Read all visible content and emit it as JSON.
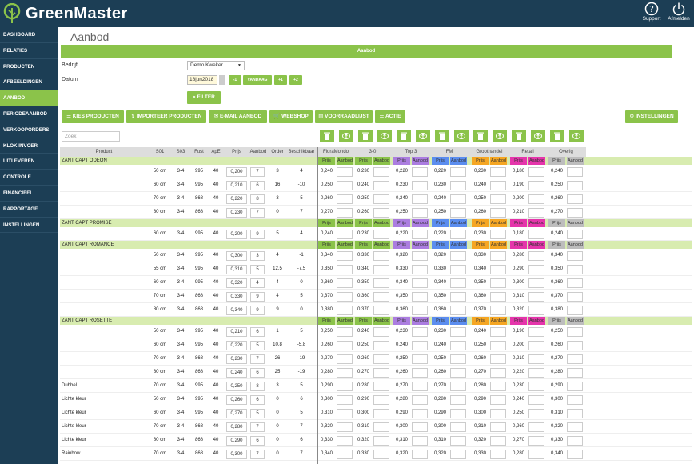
{
  "app": {
    "name": "GreenMaster",
    "support": "Support",
    "logout": "Afmelden"
  },
  "nav": [
    "DASHBOARD",
    "RELATIES",
    "PRODUCTEN",
    "AFBEELDINGEN",
    "AANBOD",
    "PERIODEAANBOD",
    "VERKOOPORDERS",
    "KLOK INVOER",
    "UITLEVEREN",
    "CONTROLE",
    "FINANCIEEL",
    "RAPPORTAGE",
    "INSTELLINGEN"
  ],
  "page": {
    "title": "Aanbod",
    "band": "Aanbod",
    "bedrijf_label": "Bedrijf",
    "bedrijf_value": "Demo Kweker",
    "datum_label": "Datum",
    "datum_value": "18jun2018",
    "day_buttons": [
      "-1",
      "VANDAAG",
      "+1",
      "+2"
    ],
    "filter": "FILTER",
    "actions": [
      "KIES PRODUCTEN",
      "IMPORTEER PRODUCTEN",
      "E-MAIL AANBOD",
      "WEBSHOP",
      "VOORRAADLIJST",
      "ACTIE"
    ],
    "settings": "INSTELLINGEN",
    "search_placeholder": "Zoek"
  },
  "columns": [
    "Product",
    "S01",
    "S03",
    "Fust",
    "ApE",
    "Prijs",
    "Aanbod",
    "Order",
    "Beschikbaar"
  ],
  "channels": [
    {
      "name": "FloraMondo",
      "color": "#8bc34a"
    },
    {
      "name": "3-0",
      "color": "#8bc34a"
    },
    {
      "name": "Top 3",
      "color": "#ab7de0"
    },
    {
      "name": "FM",
      "color": "#5b8def"
    },
    {
      "name": "Groothandel",
      "color": "#f5a623"
    },
    {
      "name": "Retail",
      "color": "#e535ab"
    },
    {
      "name": "Overig",
      "color": "#bdbdbd"
    }
  ],
  "sub_labels": {
    "price": "Prijs",
    "offer": "Aanbod"
  },
  "groups": [
    {
      "name": "ZANT CAPT ODEON",
      "rows": [
        {
          "label": "",
          "s01": "50 cm",
          "s03": "3-4",
          "fust": "995",
          "ape": "40",
          "prijs": "0,200",
          "aanbod": "7",
          "order": "3",
          "besch": "4",
          "prices": [
            "0,240",
            "0,230",
            "0,220",
            "0,220",
            "0,230",
            "0,180",
            "0,240"
          ]
        },
        {
          "label": "",
          "s01": "60 cm",
          "s03": "3-4",
          "fust": "995",
          "ape": "40",
          "prijs": "0,210",
          "aanbod": "6",
          "order": "16",
          "besch": "-10",
          "prices": [
            "0,250",
            "0,240",
            "0,230",
            "0,230",
            "0,240",
            "0,190",
            "0,250"
          ]
        },
        {
          "label": "",
          "s01": "70 cm",
          "s03": "3-4",
          "fust": "868",
          "ape": "40",
          "prijs": "0,220",
          "aanbod": "8",
          "order": "3",
          "besch": "5",
          "prices": [
            "0,260",
            "0,250",
            "0,240",
            "0,240",
            "0,250",
            "0,200",
            "0,260"
          ]
        },
        {
          "label": "",
          "s01": "80 cm",
          "s03": "3-4",
          "fust": "868",
          "ape": "40",
          "prijs": "0,230",
          "aanbod": "7",
          "order": "0",
          "besch": "7",
          "prices": [
            "0,270",
            "0,260",
            "0,250",
            "0,250",
            "0,260",
            "0,210",
            "0,270"
          ]
        }
      ]
    },
    {
      "name": "ZANT CAPT PROMISE",
      "rows": [
        {
          "label": "",
          "s01": "60 cm",
          "s03": "3-4",
          "fust": "995",
          "ape": "40",
          "prijs": "0,200",
          "aanbod": "9",
          "order": "5",
          "besch": "4",
          "prices": [
            "0,240",
            "0,230",
            "0,220",
            "0,220",
            "0,230",
            "0,180",
            "0,240"
          ]
        }
      ]
    },
    {
      "name": "ZANT CAPT ROMANCE",
      "rows": [
        {
          "label": "",
          "s01": "50 cm",
          "s03": "3-4",
          "fust": "995",
          "ape": "40",
          "prijs": "0,300",
          "aanbod": "3",
          "order": "4",
          "besch": "-1",
          "prices": [
            "0,340",
            "0,330",
            "0,320",
            "0,320",
            "0,330",
            "0,280",
            "0,340"
          ]
        },
        {
          "label": "",
          "s01": "55 cm",
          "s03": "3-4",
          "fust": "995",
          "ape": "40",
          "prijs": "0,310",
          "aanbod": "5",
          "order": "12,5",
          "besch": "-7,5",
          "prices": [
            "0,350",
            "0,340",
            "0,330",
            "0,330",
            "0,340",
            "0,290",
            "0,350"
          ]
        },
        {
          "label": "",
          "s01": "60 cm",
          "s03": "3-4",
          "fust": "995",
          "ape": "40",
          "prijs": "0,320",
          "aanbod": "4",
          "order": "4",
          "besch": "0",
          "prices": [
            "0,360",
            "0,350",
            "0,340",
            "0,340",
            "0,350",
            "0,300",
            "0,360"
          ]
        },
        {
          "label": "",
          "s01": "70 cm",
          "s03": "3-4",
          "fust": "868",
          "ape": "40",
          "prijs": "0,330",
          "aanbod": "9",
          "order": "4",
          "besch": "5",
          "prices": [
            "0,370",
            "0,360",
            "0,350",
            "0,350",
            "0,360",
            "0,310",
            "0,370"
          ]
        },
        {
          "label": "",
          "s01": "80 cm",
          "s03": "3-4",
          "fust": "868",
          "ape": "40",
          "prijs": "0,340",
          "aanbod": "9",
          "order": "9",
          "besch": "0",
          "prices": [
            "0,380",
            "0,370",
            "0,360",
            "0,360",
            "0,370",
            "0,320",
            "0,380"
          ]
        }
      ]
    },
    {
      "name": "ZANT CAPT ROSETTE",
      "rows": [
        {
          "label": "",
          "s01": "50 cm",
          "s03": "3-4",
          "fust": "995",
          "ape": "40",
          "prijs": "0,210",
          "aanbod": "6",
          "order": "1",
          "besch": "5",
          "prices": [
            "0,250",
            "0,240",
            "0,230",
            "0,230",
            "0,240",
            "0,190",
            "0,250"
          ]
        },
        {
          "label": "",
          "s01": "60 cm",
          "s03": "3-4",
          "fust": "995",
          "ape": "40",
          "prijs": "0,220",
          "aanbod": "5",
          "order": "10,8",
          "besch": "-5,8",
          "prices": [
            "0,260",
            "0,250",
            "0,240",
            "0,240",
            "0,250",
            "0,200",
            "0,260"
          ]
        },
        {
          "label": "",
          "s01": "70 cm",
          "s03": "3-4",
          "fust": "868",
          "ape": "40",
          "prijs": "0,230",
          "aanbod": "7",
          "order": "26",
          "besch": "-19",
          "prices": [
            "0,270",
            "0,260",
            "0,250",
            "0,250",
            "0,260",
            "0,210",
            "0,270"
          ]
        },
        {
          "label": "",
          "s01": "80 cm",
          "s03": "3-4",
          "fust": "868",
          "ape": "40",
          "prijs": "0,240",
          "aanbod": "6",
          "order": "25",
          "besch": "-19",
          "prices": [
            "0,280",
            "0,270",
            "0,260",
            "0,260",
            "0,270",
            "0,220",
            "0,280"
          ]
        },
        {
          "label": "Dubbel",
          "s01": "70 cm",
          "s03": "3-4",
          "fust": "995",
          "ape": "40",
          "prijs": "0,250",
          "aanbod": "8",
          "order": "3",
          "besch": "5",
          "prices": [
            "0,290",
            "0,280",
            "0,270",
            "0,270",
            "0,280",
            "0,230",
            "0,290"
          ]
        },
        {
          "label": "Lichte kleur",
          "s01": "50 cm",
          "s03": "3-4",
          "fust": "995",
          "ape": "40",
          "prijs": "0,260",
          "aanbod": "6",
          "order": "0",
          "besch": "6",
          "prices": [
            "0,300",
            "0,290",
            "0,280",
            "0,280",
            "0,290",
            "0,240",
            "0,300"
          ]
        },
        {
          "label": "Lichte kleur",
          "s01": "60 cm",
          "s03": "3-4",
          "fust": "995",
          "ape": "40",
          "prijs": "0,270",
          "aanbod": "5",
          "order": "0",
          "besch": "5",
          "prices": [
            "0,310",
            "0,300",
            "0,290",
            "0,290",
            "0,300",
            "0,250",
            "0,310"
          ]
        },
        {
          "label": "Lichte kleur",
          "s01": "70 cm",
          "s03": "3-4",
          "fust": "868",
          "ape": "40",
          "prijs": "0,280",
          "aanbod": "7",
          "order": "0",
          "besch": "7",
          "prices": [
            "0,320",
            "0,310",
            "0,300",
            "0,300",
            "0,310",
            "0,260",
            "0,320"
          ]
        },
        {
          "label": "Lichte kleur",
          "s01": "80 cm",
          "s03": "3-4",
          "fust": "868",
          "ape": "40",
          "prijs": "0,290",
          "aanbod": "6",
          "order": "0",
          "besch": "6",
          "prices": [
            "0,330",
            "0,320",
            "0,310",
            "0,310",
            "0,320",
            "0,270",
            "0,330"
          ]
        },
        {
          "label": "Rainbow",
          "s01": "70 cm",
          "s03": "3-4",
          "fust": "868",
          "ape": "40",
          "prijs": "0,300",
          "aanbod": "7",
          "order": "0",
          "besch": "7",
          "prices": [
            "0,340",
            "0,330",
            "0,320",
            "0,320",
            "0,330",
            "0,280",
            "0,340"
          ]
        }
      ]
    }
  ]
}
